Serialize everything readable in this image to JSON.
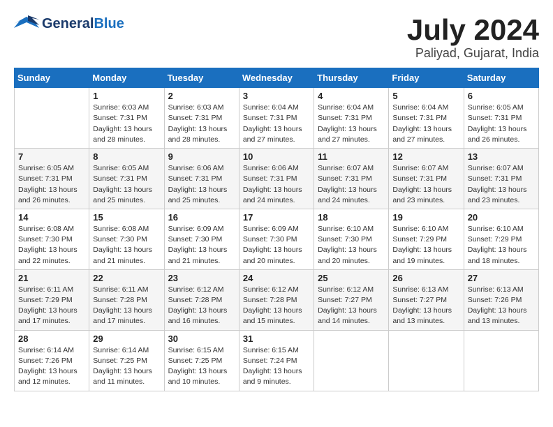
{
  "header": {
    "logo_general": "General",
    "logo_blue": "Blue",
    "month": "July 2024",
    "location": "Paliyad, Gujarat, India"
  },
  "days_of_week": [
    "Sunday",
    "Monday",
    "Tuesday",
    "Wednesday",
    "Thursday",
    "Friday",
    "Saturday"
  ],
  "weeks": [
    [
      {
        "day": "",
        "sunrise": "",
        "sunset": "",
        "daylight": ""
      },
      {
        "day": "1",
        "sunrise": "Sunrise: 6:03 AM",
        "sunset": "Sunset: 7:31 PM",
        "daylight": "Daylight: 13 hours and 28 minutes."
      },
      {
        "day": "2",
        "sunrise": "Sunrise: 6:03 AM",
        "sunset": "Sunset: 7:31 PM",
        "daylight": "Daylight: 13 hours and 28 minutes."
      },
      {
        "day": "3",
        "sunrise": "Sunrise: 6:04 AM",
        "sunset": "Sunset: 7:31 PM",
        "daylight": "Daylight: 13 hours and 27 minutes."
      },
      {
        "day": "4",
        "sunrise": "Sunrise: 6:04 AM",
        "sunset": "Sunset: 7:31 PM",
        "daylight": "Daylight: 13 hours and 27 minutes."
      },
      {
        "day": "5",
        "sunrise": "Sunrise: 6:04 AM",
        "sunset": "Sunset: 7:31 PM",
        "daylight": "Daylight: 13 hours and 27 minutes."
      },
      {
        "day": "6",
        "sunrise": "Sunrise: 6:05 AM",
        "sunset": "Sunset: 7:31 PM",
        "daylight": "Daylight: 13 hours and 26 minutes."
      }
    ],
    [
      {
        "day": "7",
        "sunrise": "Sunrise: 6:05 AM",
        "sunset": "Sunset: 7:31 PM",
        "daylight": "Daylight: 13 hours and 26 minutes."
      },
      {
        "day": "8",
        "sunrise": "Sunrise: 6:05 AM",
        "sunset": "Sunset: 7:31 PM",
        "daylight": "Daylight: 13 hours and 25 minutes."
      },
      {
        "day": "9",
        "sunrise": "Sunrise: 6:06 AM",
        "sunset": "Sunset: 7:31 PM",
        "daylight": "Daylight: 13 hours and 25 minutes."
      },
      {
        "day": "10",
        "sunrise": "Sunrise: 6:06 AM",
        "sunset": "Sunset: 7:31 PM",
        "daylight": "Daylight: 13 hours and 24 minutes."
      },
      {
        "day": "11",
        "sunrise": "Sunrise: 6:07 AM",
        "sunset": "Sunset: 7:31 PM",
        "daylight": "Daylight: 13 hours and 24 minutes."
      },
      {
        "day": "12",
        "sunrise": "Sunrise: 6:07 AM",
        "sunset": "Sunset: 7:31 PM",
        "daylight": "Daylight: 13 hours and 23 minutes."
      },
      {
        "day": "13",
        "sunrise": "Sunrise: 6:07 AM",
        "sunset": "Sunset: 7:31 PM",
        "daylight": "Daylight: 13 hours and 23 minutes."
      }
    ],
    [
      {
        "day": "14",
        "sunrise": "Sunrise: 6:08 AM",
        "sunset": "Sunset: 7:30 PM",
        "daylight": "Daylight: 13 hours and 22 minutes."
      },
      {
        "day": "15",
        "sunrise": "Sunrise: 6:08 AM",
        "sunset": "Sunset: 7:30 PM",
        "daylight": "Daylight: 13 hours and 21 minutes."
      },
      {
        "day": "16",
        "sunrise": "Sunrise: 6:09 AM",
        "sunset": "Sunset: 7:30 PM",
        "daylight": "Daylight: 13 hours and 21 minutes."
      },
      {
        "day": "17",
        "sunrise": "Sunrise: 6:09 AM",
        "sunset": "Sunset: 7:30 PM",
        "daylight": "Daylight: 13 hours and 20 minutes."
      },
      {
        "day": "18",
        "sunrise": "Sunrise: 6:10 AM",
        "sunset": "Sunset: 7:30 PM",
        "daylight": "Daylight: 13 hours and 20 minutes."
      },
      {
        "day": "19",
        "sunrise": "Sunrise: 6:10 AM",
        "sunset": "Sunset: 7:29 PM",
        "daylight": "Daylight: 13 hours and 19 minutes."
      },
      {
        "day": "20",
        "sunrise": "Sunrise: 6:10 AM",
        "sunset": "Sunset: 7:29 PM",
        "daylight": "Daylight: 13 hours and 18 minutes."
      }
    ],
    [
      {
        "day": "21",
        "sunrise": "Sunrise: 6:11 AM",
        "sunset": "Sunset: 7:29 PM",
        "daylight": "Daylight: 13 hours and 17 minutes."
      },
      {
        "day": "22",
        "sunrise": "Sunrise: 6:11 AM",
        "sunset": "Sunset: 7:28 PM",
        "daylight": "Daylight: 13 hours and 17 minutes."
      },
      {
        "day": "23",
        "sunrise": "Sunrise: 6:12 AM",
        "sunset": "Sunset: 7:28 PM",
        "daylight": "Daylight: 13 hours and 16 minutes."
      },
      {
        "day": "24",
        "sunrise": "Sunrise: 6:12 AM",
        "sunset": "Sunset: 7:28 PM",
        "daylight": "Daylight: 13 hours and 15 minutes."
      },
      {
        "day": "25",
        "sunrise": "Sunrise: 6:12 AM",
        "sunset": "Sunset: 7:27 PM",
        "daylight": "Daylight: 13 hours and 14 minutes."
      },
      {
        "day": "26",
        "sunrise": "Sunrise: 6:13 AM",
        "sunset": "Sunset: 7:27 PM",
        "daylight": "Daylight: 13 hours and 13 minutes."
      },
      {
        "day": "27",
        "sunrise": "Sunrise: 6:13 AM",
        "sunset": "Sunset: 7:26 PM",
        "daylight": "Daylight: 13 hours and 13 minutes."
      }
    ],
    [
      {
        "day": "28",
        "sunrise": "Sunrise: 6:14 AM",
        "sunset": "Sunset: 7:26 PM",
        "daylight": "Daylight: 13 hours and 12 minutes."
      },
      {
        "day": "29",
        "sunrise": "Sunrise: 6:14 AM",
        "sunset": "Sunset: 7:25 PM",
        "daylight": "Daylight: 13 hours and 11 minutes."
      },
      {
        "day": "30",
        "sunrise": "Sunrise: 6:15 AM",
        "sunset": "Sunset: 7:25 PM",
        "daylight": "Daylight: 13 hours and 10 minutes."
      },
      {
        "day": "31",
        "sunrise": "Sunrise: 6:15 AM",
        "sunset": "Sunset: 7:24 PM",
        "daylight": "Daylight: 13 hours and 9 minutes."
      },
      {
        "day": "",
        "sunrise": "",
        "sunset": "",
        "daylight": ""
      },
      {
        "day": "",
        "sunrise": "",
        "sunset": "",
        "daylight": ""
      },
      {
        "day": "",
        "sunrise": "",
        "sunset": "",
        "daylight": ""
      }
    ]
  ]
}
